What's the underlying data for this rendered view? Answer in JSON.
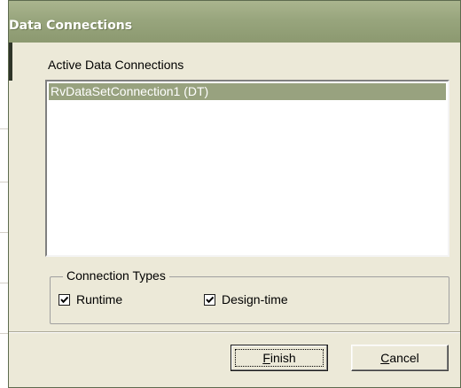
{
  "dialog": {
    "title": "Data Connections"
  },
  "connections": {
    "label": "Active Data Connections",
    "items": [
      "RvDataSetConnection1 (DT)"
    ],
    "selected_index": 0
  },
  "connection_types": {
    "legend": "Connection Types",
    "runtime": {
      "label": "Runtime",
      "checked": true
    },
    "design_time": {
      "label": "Design-time",
      "checked": true
    }
  },
  "buttons": {
    "finish": {
      "label": "Finish",
      "mnemonic": "F"
    },
    "cancel": {
      "label": "Cancel",
      "mnemonic": "C"
    }
  },
  "colors": {
    "titlebar": "#98a57d",
    "selection": "#98a27f",
    "dialog_bg": "#ece9d8"
  }
}
